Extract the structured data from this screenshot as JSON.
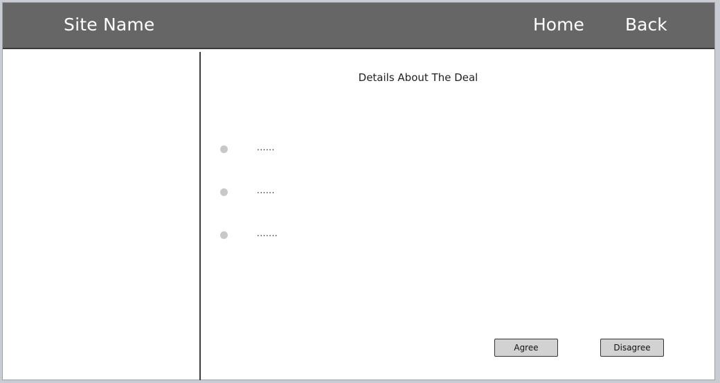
{
  "header": {
    "site_name": "Site Name",
    "nav": {
      "home": "Home",
      "back": "Back"
    }
  },
  "main": {
    "title": "Details About The Deal",
    "bullets": [
      {
        "text": "......"
      },
      {
        "text": "......"
      },
      {
        "text": "......."
      }
    ],
    "buttons": {
      "agree": "Agree",
      "disagree": "Disagree"
    }
  },
  "colors": {
    "header_bg": "#666666",
    "button_bg": "#d2d2d2",
    "bullet_dot": "#c8c8c8"
  }
}
